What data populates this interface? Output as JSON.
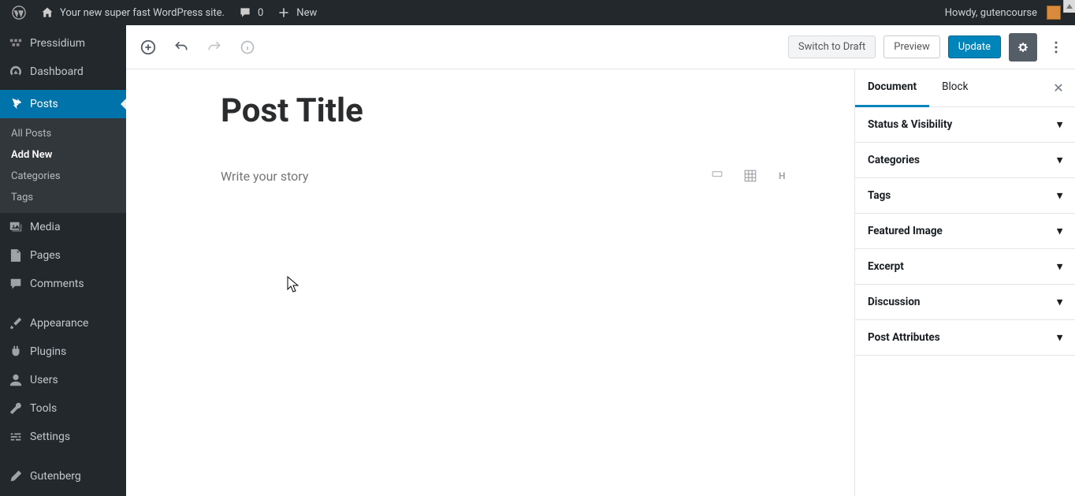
{
  "adminbar": {
    "site_name": "Your new super fast WordPress site.",
    "comments_count": "0",
    "new_label": "New",
    "howdy": "Howdy, gutencourse"
  },
  "sidemenu": {
    "pressidium": "Pressidium",
    "dashboard": "Dashboard",
    "posts": "Posts",
    "sub_all": "All Posts",
    "sub_add": "Add New",
    "sub_cats": "Categories",
    "sub_tags": "Tags",
    "media": "Media",
    "pages": "Pages",
    "comments": "Comments",
    "appearance": "Appearance",
    "plugins": "Plugins",
    "users": "Users",
    "tools": "Tools",
    "settings": "Settings",
    "gutenberg": "Gutenberg"
  },
  "toolbar": {
    "switch_draft": "Switch to Draft",
    "preview": "Preview",
    "update": "Update"
  },
  "editor": {
    "title": "Post Title",
    "story_placeholder": "Write your story"
  },
  "settings": {
    "tab_document": "Document",
    "tab_block": "Block",
    "panels": {
      "status": "Status & Visibility",
      "categories": "Categories",
      "tags": "Tags",
      "featured": "Featured Image",
      "excerpt": "Excerpt",
      "discussion": "Discussion",
      "attributes": "Post Attributes"
    }
  }
}
